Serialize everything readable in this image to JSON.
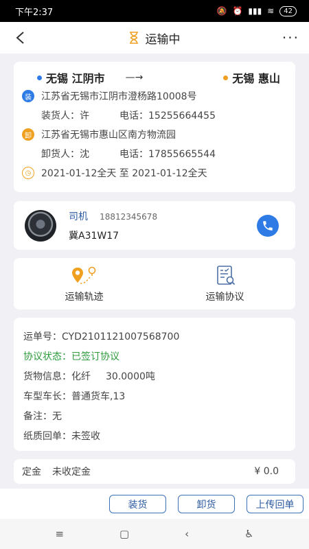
{
  "status_bar": {
    "time": "下午2:37",
    "battery": "42"
  },
  "nav": {
    "title": "运输中",
    "more_label": "···"
  },
  "route": {
    "from_city": "无锡 江阴市",
    "arrow": "—→",
    "to_city": "无锡 惠山",
    "load_badge": "装",
    "load_address": "江苏省无锡市江阴市澄杨路10008号",
    "loader_label": "装货人：许",
    "loader_phone": "电话：15255664455",
    "unload_badge": "卸",
    "unload_address": "江苏省无锡市惠山区南方物流园",
    "unloader_label": "卸货人：沈",
    "unloader_phone": "电话：17855665544",
    "date_range": "2021-01-12全天 至 2021-01-12全天"
  },
  "driver": {
    "label": "司机",
    "phone": "18812345678",
    "plate": "冀A31W17"
  },
  "actions": {
    "track_label": "运输轨迹",
    "agreement_label": "运输协议"
  },
  "order": {
    "waybill": "运单号：CYD210112100756870​0",
    "agreement_status": "协议状态：已签订协议",
    "cargo_label": "货物信息：化纤",
    "cargo_weight": "30.0000吨",
    "vehicle": "车型车长：普通货车,13",
    "remark": "备注：无",
    "receipt": "纸质回单：未签收"
  },
  "deposit": {
    "label": "定金",
    "status": "未收定金",
    "amount": "¥ 0.0"
  },
  "bottom_buttons": {
    "load": "装货",
    "unload": "卸货",
    "upload_receipt": "上传回单"
  },
  "colors": {
    "accent_blue": "#2e7be6",
    "orange": "#f0a020",
    "green": "#2e9a3c"
  }
}
